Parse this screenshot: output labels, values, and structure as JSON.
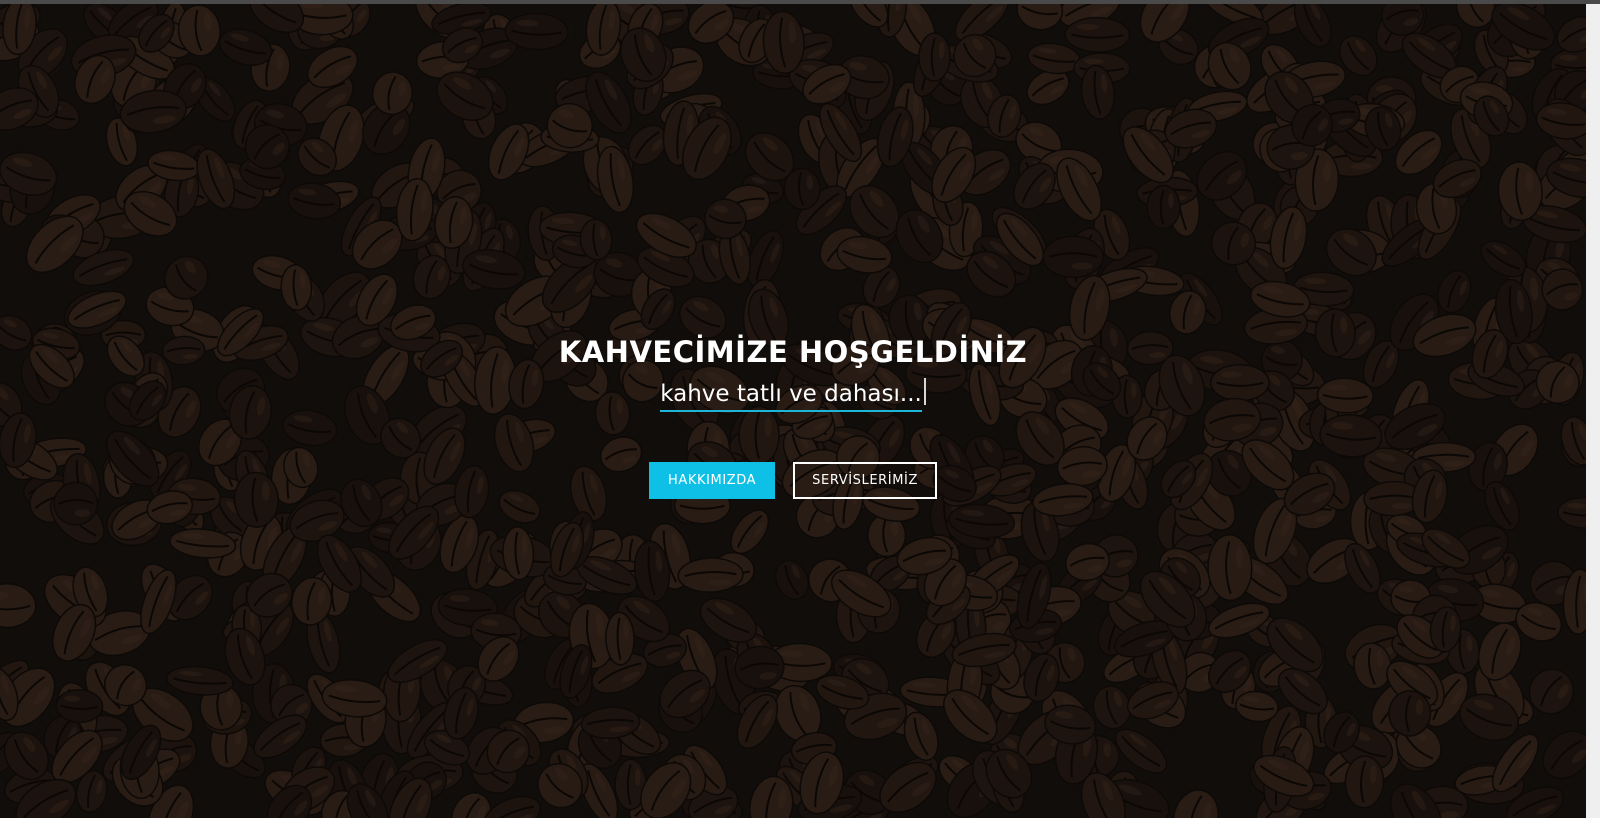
{
  "hero": {
    "title": "KAHVECİMİZE HOŞGELDİNİZ",
    "subtitle": "kahve tatlı ve dahası...",
    "background": "coffee-beans-image",
    "accent_color": "#0ec0e6",
    "underline_color": "#1db6d6"
  },
  "buttons": {
    "about_label": "HAKKIMIZDA",
    "services_label": "SERVİSLERİMİZ"
  }
}
